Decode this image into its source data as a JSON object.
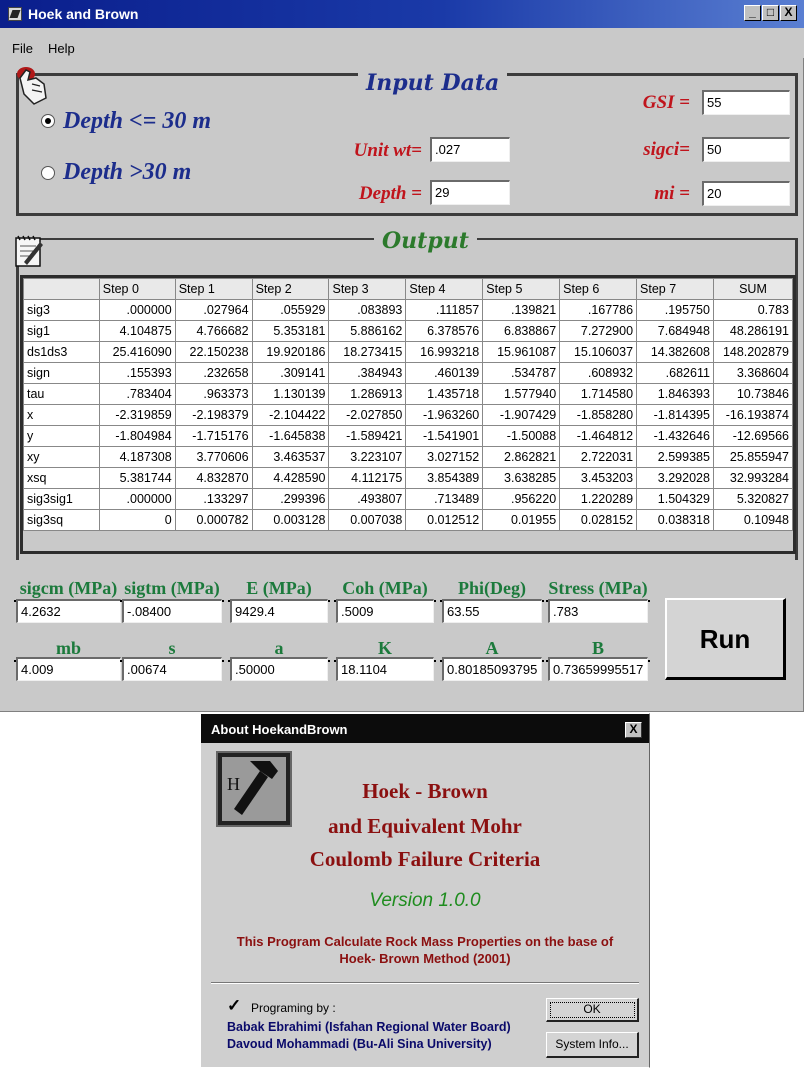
{
  "window": {
    "title": "Hoek and Brown",
    "minimize": "_",
    "maximize": "□",
    "close": "X"
  },
  "menu": [
    "File",
    "Help"
  ],
  "input": {
    "title": "Input Data",
    "radio_depth_le": "Depth <= 30 m",
    "radio_depth_gt": "Depth >30 m",
    "unit_wt_label": "Unit wt=",
    "unit_wt_value": ".027",
    "depth_label": "Depth =",
    "depth_value": "29",
    "gsi_label": "GSI =",
    "gsi_value": "55",
    "sigci_label": "sigci=",
    "sigci_value": "50",
    "mi_label": "mi =",
    "mi_value": "20"
  },
  "output": {
    "title": "Output",
    "headers": [
      "",
      "Step 0",
      "Step 1",
      "Step 2",
      "Step 3",
      "Step 4",
      "Step 5",
      "Step 6",
      "Step 7",
      "SUM"
    ],
    "rows": [
      [
        "sig3",
        ".000000",
        ".027964",
        ".055929",
        ".083893",
        ".111857",
        ".139821",
        ".167786",
        ".195750",
        "0.783"
      ],
      [
        "sig1",
        "4.104875",
        "4.766682",
        "5.353181",
        "5.886162",
        "6.378576",
        "6.838867",
        "7.272900",
        "7.684948",
        "48.286191"
      ],
      [
        "ds1ds3",
        "25.416090",
        "22.150238",
        "19.920186",
        "18.273415",
        "16.993218",
        "15.961087",
        "15.106037",
        "14.382608",
        "148.202879"
      ],
      [
        "sign",
        ".155393",
        ".232658",
        ".309141",
        ".384943",
        ".460139",
        ".534787",
        ".608932",
        ".682611",
        "3.368604"
      ],
      [
        "tau",
        ".783404",
        ".963373",
        "1.130139",
        "1.286913",
        "1.435718",
        "1.577940",
        "1.714580",
        "1.846393",
        "10.73846"
      ],
      [
        "x",
        "-2.319859",
        "-2.198379",
        "-2.104422",
        "-2.027850",
        "-1.963260",
        "-1.907429",
        "-1.858280",
        "-1.814395",
        "-16.193874"
      ],
      [
        "y",
        "-1.804984",
        "-1.715176",
        "-1.645838",
        "-1.589421",
        "-1.541901",
        "-1.50088",
        "-1.464812",
        "-1.432646",
        "-12.69566"
      ],
      [
        "xy",
        "4.187308",
        "3.770606",
        "3.463537",
        "3.223107",
        "3.027152",
        "2.862821",
        "2.722031",
        "2.599385",
        "25.855947"
      ],
      [
        "xsq",
        "5.381744",
        "4.832870",
        "4.428590",
        "4.112175",
        "3.854389",
        "3.638285",
        "3.453203",
        "3.292028",
        "32.993284"
      ],
      [
        "sig3sig1",
        ".000000",
        ".133297",
        ".299396",
        ".493807",
        ".713489",
        ".956220",
        "1.220289",
        "1.504329",
        "5.320827"
      ],
      [
        "sig3sq",
        "0",
        "0.000782",
        "0.003128",
        "0.007038",
        "0.012512",
        "0.01955",
        "0.028152",
        "0.038318",
        "0.10948"
      ]
    ]
  },
  "results": {
    "sigcm_label": "sigcm (MPa)",
    "sigcm_value": "4.2632",
    "sigtm_label": "sigtm (MPa)",
    "sigtm_value": "-.08400",
    "e_label": "E (MPa)",
    "e_value": "9429.4",
    "coh_label": "Coh (MPa)",
    "coh_value": ".5009",
    "phi_label": "Phi(Deg)",
    "phi_value": "63.55",
    "stress_label": "Stress (MPa)",
    "stress_value": ".783",
    "mb_label": "mb",
    "mb_value": "4.009",
    "s_label": "s",
    "s_value": ".00674",
    "a_label": "a",
    "a_value": ".50000",
    "k_label": "K",
    "k_value": "18.1104",
    "A_label": "A",
    "A_value": "0.80185093795",
    "B_label": "B",
    "B_value": "0.73659995517",
    "run_label": "Run"
  },
  "about": {
    "title": "About HoekandBrown",
    "close": "X",
    "logo_letter": "H",
    "heading1": "Hoek - Brown",
    "heading2": "and Equivalent Mohr",
    "heading3": "Coulomb Failure Criteria",
    "version": "Version 1.0.0",
    "desc1": "This Program Calculate Rock Mass Properties on the base of",
    "desc2": "Hoek- Brown  Method (2001)",
    "programing_by": "Programing by :",
    "author1": "Babak Ebrahimi (Isfahan Regional Water Board)",
    "author2": "Davoud Mohammadi (Bu-Ali Sina University)",
    "ok": "OK",
    "system_info": "System Info..."
  }
}
